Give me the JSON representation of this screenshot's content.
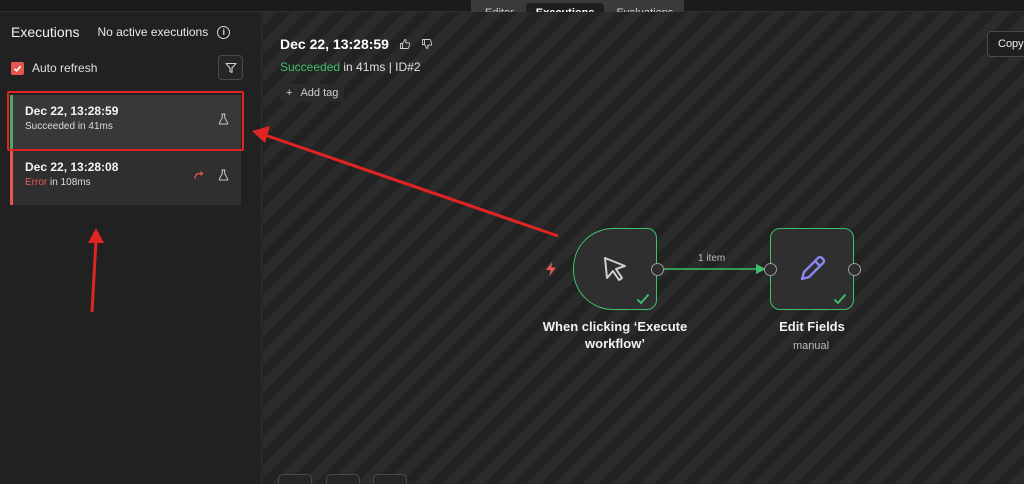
{
  "tabs": [
    {
      "label": "Editor"
    },
    {
      "label": "Executions",
      "active": true
    },
    {
      "label": "Evaluations"
    }
  ],
  "sidebar": {
    "title": "Executions",
    "status": "No active executions",
    "auto_refresh_label": "Auto refresh",
    "auto_refresh_checked": true,
    "executions": [
      {
        "date": "Dec 22, 13:28:59",
        "status_word": "Succeeded",
        "status_rest": " in 41ms",
        "state": "success"
      },
      {
        "date": "Dec 22, 13:28:08",
        "status_word": "Error",
        "status_rest": " in 108ms",
        "state": "error"
      }
    ]
  },
  "main": {
    "execution_date": "Dec 22, 13:28:59",
    "status_word": "Succeeded",
    "status_rest": " in 41ms | ID#2",
    "add_tag_label": "Add tag",
    "copy_label": "Copy"
  },
  "workflow": {
    "trigger_label_line1": "When clicking ‘Execute",
    "trigger_label_line2": "workflow’",
    "edit_label": "Edit Fields",
    "edit_sub": "manual",
    "connection_label": "1 item"
  },
  "colors": {
    "success": "#3fbf6a",
    "error": "#e5574c",
    "annotation": "#e02424",
    "node_icon_purple": "#8b86f0"
  }
}
